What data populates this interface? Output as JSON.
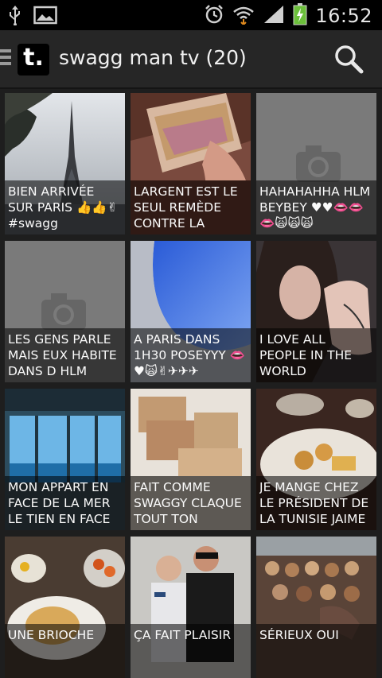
{
  "status_bar": {
    "time": "16:52",
    "icons": [
      "usb-icon",
      "image-icon",
      "alarm-icon",
      "wifi-icon",
      "signal-icon",
      "battery-charging-icon"
    ]
  },
  "action_bar": {
    "logo_text": "t.",
    "title": "swagg man tv (20)",
    "icons": [
      "menu-icon",
      "search-icon"
    ]
  },
  "posts": [
    {
      "caption": "BIEN ARRIVÉE SUR PARIS 👍👍✌ #swagg",
      "image": "eiffel-tower-photo"
    },
    {
      "caption": "LARGENT EST LE SEUL REMÈDE CONTRE LA",
      "image": "money-in-hand-photo"
    },
    {
      "caption": "HAHAHAHHA HLM BEYBEY ♥♥👄👄👄🙀🙀🙀",
      "image": "placeholder-camera"
    },
    {
      "caption": "LES GENS PARLE MAIS EUX HABITE DANS D HLM",
      "image": "placeholder-camera"
    },
    {
      "caption": "A PARIS DANS 1H30 POSEYYY 👄♥🙀✌✈✈✈",
      "image": "airplane-window-photo"
    },
    {
      "caption": "I LOVE ALL PEOPLE IN THE WORLD",
      "image": "girl-selfie-photo"
    },
    {
      "caption": "MON APPART EN FACE DE LA MER LE TIEN EN FACE",
      "image": "sea-view-apartment-photo"
    },
    {
      "caption": "FAIT COMME SWAGGY CLAQUE TOUT TON",
      "image": "money-stacks-photo"
    },
    {
      "caption": "JE MANGE CHEZ LE PRÉSIDENT DE LA TUNISIE JAIME",
      "image": "food-plate-photo"
    },
    {
      "caption": "UNE BRIOCHE",
      "image": "brioche-photo"
    },
    {
      "caption": "ÇA FAIT PLAISIR",
      "image": "two-men-photo"
    },
    {
      "caption": "SÉRIEUX OUI",
      "image": "pastries-photo"
    }
  ]
}
